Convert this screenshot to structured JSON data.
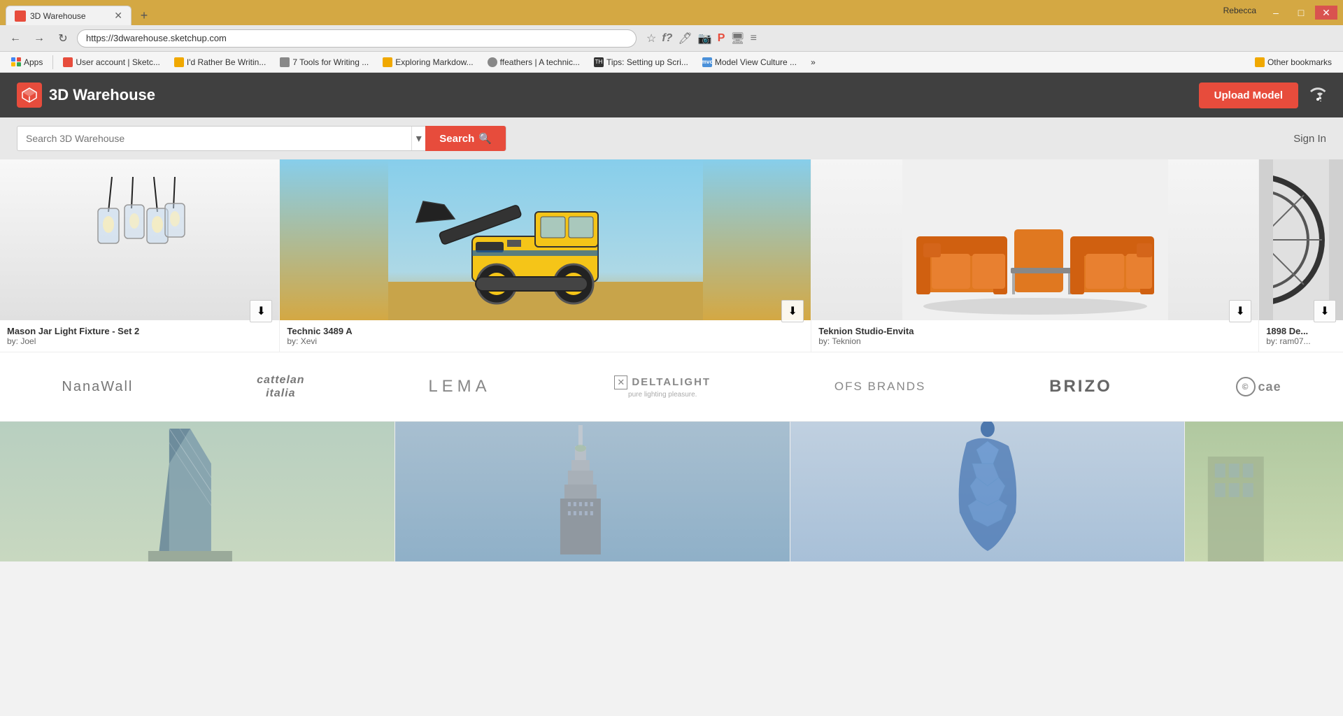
{
  "browser": {
    "tab": {
      "title": "3D Warehouse",
      "favicon": "3DW",
      "url": "https://3dwarehouse.sketchup.com"
    },
    "window_controls": {
      "minimize": "–",
      "maximize": "□",
      "close": "✕"
    },
    "user_label": "Rebecca",
    "nav": {
      "back": "←",
      "forward": "→",
      "refresh": "↻"
    },
    "bookmarks": [
      {
        "id": "apps",
        "label": "Apps",
        "type": "grid"
      },
      {
        "id": "user-account",
        "label": "User account | Sketc...",
        "type": "bookmark"
      },
      {
        "id": "id-rather",
        "label": "I'd Rather Be Writin...",
        "type": "folder"
      },
      {
        "id": "tools-writing",
        "label": "7 Tools for Writing ...",
        "type": "bookmark"
      },
      {
        "id": "exploring-markdown",
        "label": "Exploring Markdow...",
        "type": "folder"
      },
      {
        "id": "ffeathers",
        "label": "ffeathers | A technic...",
        "type": "bookmark"
      },
      {
        "id": "tips-setting",
        "label": "Tips: Setting up Scri...",
        "type": "bookmark"
      },
      {
        "id": "model-view",
        "label": "Model View Culture ...",
        "type": "bookmark"
      },
      {
        "id": "more",
        "label": "»",
        "type": "more"
      },
      {
        "id": "other",
        "label": "Other bookmarks",
        "type": "folder"
      }
    ]
  },
  "site": {
    "logo_text": "3D Warehouse",
    "upload_btn": "Upload Model",
    "search_placeholder": "Search 3D Warehouse",
    "search_btn": "Search",
    "sign_in": "Sign In"
  },
  "models": [
    {
      "id": "mason-jar",
      "title": "Mason Jar Light Fixture - Set 2",
      "author": "by: Joel",
      "thumb_type": "mason"
    },
    {
      "id": "technic",
      "title": "Technic 3489 A",
      "author": "by: Xevi",
      "thumb_type": "technic"
    },
    {
      "id": "teknion",
      "title": "Teknion Studio-Envita",
      "author": "by: Teknion",
      "thumb_type": "sofa"
    },
    {
      "id": "partial",
      "title": "1898 De...",
      "author": "by: ram07...",
      "thumb_type": "partial"
    }
  ],
  "brands": [
    {
      "id": "nanawall",
      "label": "NanaWall",
      "class": "plain"
    },
    {
      "id": "cattelan",
      "label": "cattelan\nitalia",
      "class": "italic"
    },
    {
      "id": "lema",
      "label": "LEMA",
      "class": "spaced"
    },
    {
      "id": "deltalight",
      "label": "DELTALIGHT",
      "sub": "pure lighting pleasure.",
      "class": "delta"
    },
    {
      "id": "ofs",
      "label": "OFS BRANDS",
      "class": "plain"
    },
    {
      "id": "brizo",
      "label": "BRIZO",
      "class": "bold"
    },
    {
      "id": "cae",
      "label": "© cae...",
      "class": "plain"
    }
  ],
  "buildings": [
    {
      "id": "bldg1",
      "thumb_type": "1"
    },
    {
      "id": "bldg2",
      "thumb_type": "2"
    },
    {
      "id": "bldg3",
      "thumb_type": "3"
    },
    {
      "id": "bldg4",
      "thumb_type": "4"
    }
  ],
  "icons": {
    "search": "🔍",
    "download": "⬇",
    "dropdown": "▾",
    "wifi": "📶",
    "star": "☆",
    "extensions": "f?",
    "pin": "📌",
    "pinterest": "𝗣",
    "grid": "⊞"
  }
}
